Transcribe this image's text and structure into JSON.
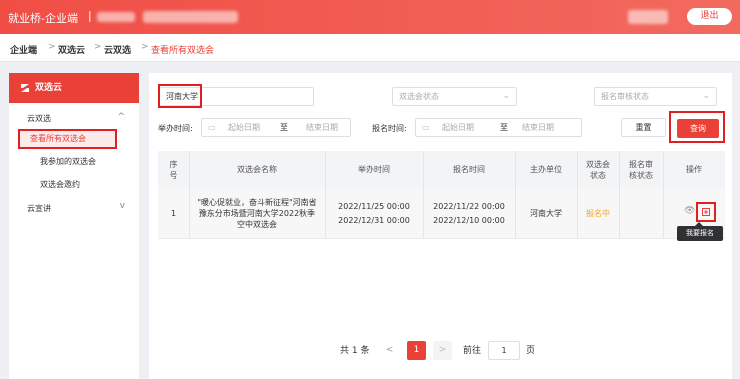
{
  "header": {
    "brand": "就业桥-企业端",
    "separator": "|",
    "logout": "退出"
  },
  "breadcrumb": {
    "items": [
      "企业端",
      "双选云",
      "云双选"
    ],
    "current": "查看所有双选会",
    "sep": ">"
  },
  "sidebar": {
    "title": "双选云",
    "groups": [
      {
        "label": "云双选",
        "chevron": "^"
      },
      {
        "label": "云宣讲",
        "chevron": "v"
      }
    ],
    "items": [
      "查看所有双选会",
      "我参加的双选会",
      "双选会邀约"
    ]
  },
  "filters": {
    "keyword": "河南大学",
    "status_placeholder": "双选会状态",
    "audit_placeholder": "报名审核状态",
    "hold_time_label": "举办时间:",
    "signup_time_label": "报名时间:",
    "start_placeholder": "起始日期",
    "to": "至",
    "end_placeholder": "结束日期",
    "reset": "重置",
    "query": "查询"
  },
  "table": {
    "headers": [
      "序号",
      "双选会名称",
      "举办时间",
      "报名时间",
      "主办单位",
      "双选会状态",
      "报名审核状态",
      "操作"
    ],
    "rows": [
      {
        "index": "1",
        "name": "\"暖心促就业，奋斗新征程\"河南省豫东分市场暨河南大学2022秋季空中双选会",
        "hold_start": "2022/11/25 00:00",
        "hold_end": "2022/12/31 00:00",
        "signup_start": "2022/11/22 00:00",
        "signup_end": "2022/12/10 00:00",
        "organizer": "河南大学",
        "status": "报名中",
        "audit": ""
      }
    ],
    "tooltip": "我要报名"
  },
  "pagination": {
    "total": "共 1 条",
    "prev": "<",
    "current": "1",
    "next": ">",
    "goto": "前往",
    "page_input": "1",
    "page_unit": "页"
  },
  "colors": {
    "accent": "#e94037",
    "status": "#f5a623"
  },
  "icons": [
    "eye-icon",
    "signup-icon",
    "calendar-icon",
    "chevron-down-icon"
  ]
}
